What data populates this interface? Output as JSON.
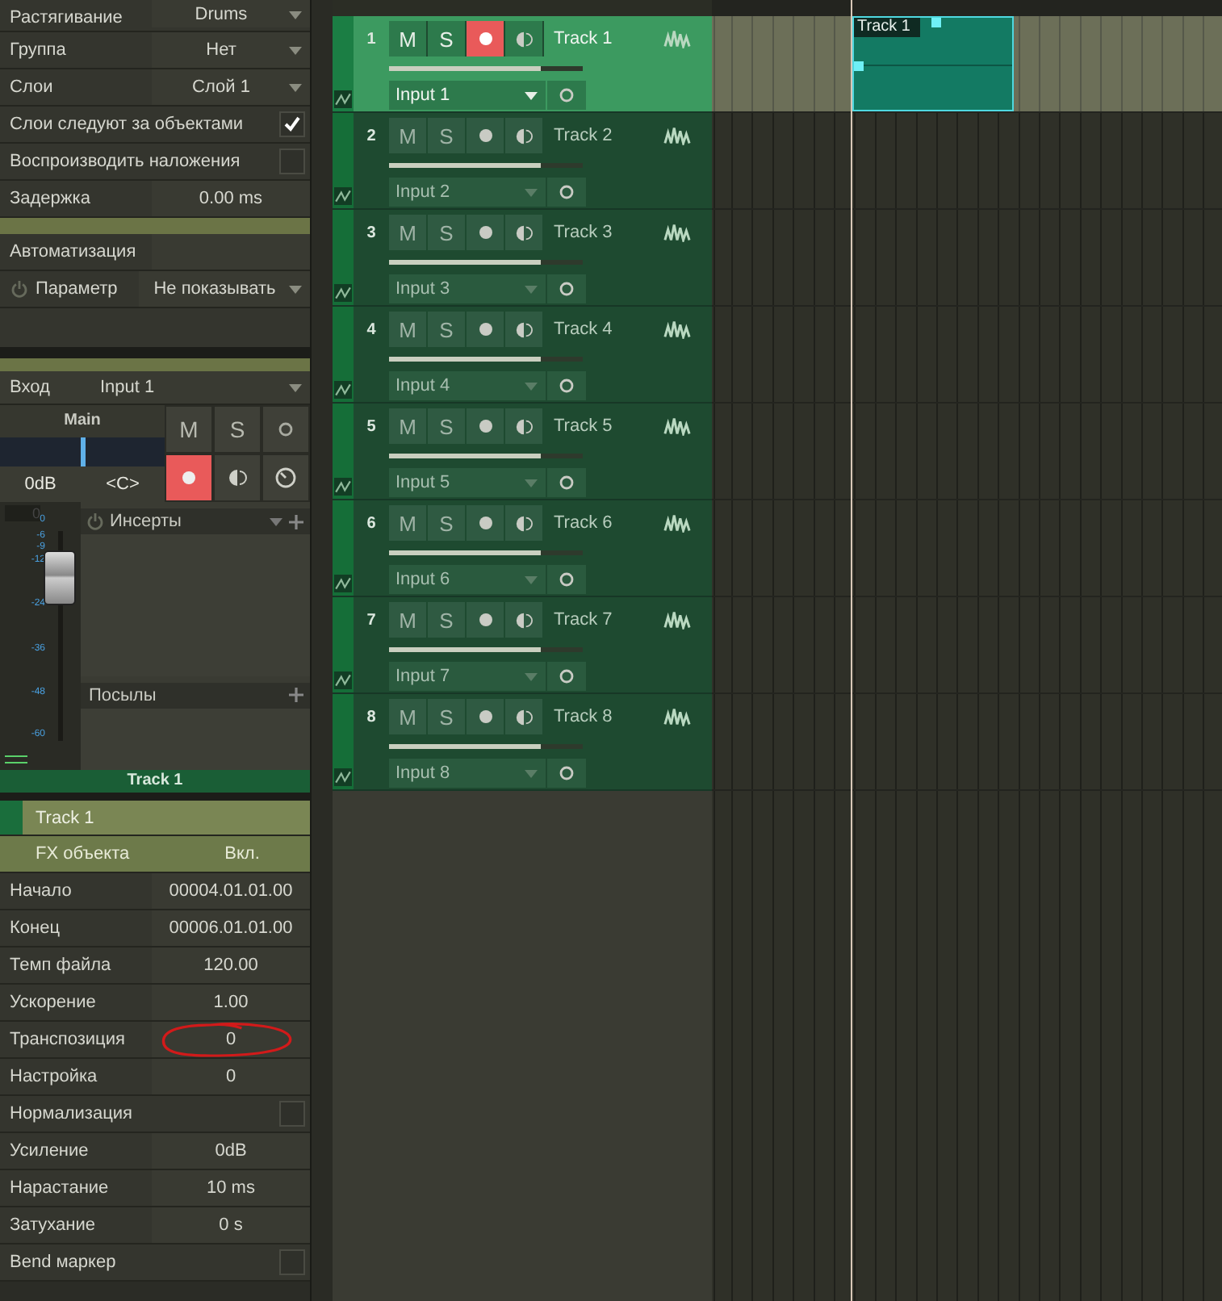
{
  "inspector": {
    "rows": [
      {
        "kind": "select",
        "label": "Растягивание",
        "value": "Drums"
      },
      {
        "kind": "select",
        "label": "Группа",
        "value": "Нет"
      },
      {
        "kind": "select",
        "label": "Слои",
        "value": "Слой 1"
      },
      {
        "kind": "check",
        "label": "Слои следуют за объектами",
        "checked": true
      },
      {
        "kind": "check",
        "label": "Воспроизводить наложения",
        "checked": false
      },
      {
        "kind": "value",
        "label": "Задержка",
        "value": "0.00 ms"
      }
    ]
  },
  "automation": {
    "label": "Автоматизация",
    "param_label": "Параметр",
    "param_value": "Не показывать"
  },
  "input": {
    "label": "Вход",
    "value": "Input 1"
  },
  "channel_strip": {
    "output": "Main",
    "mute_label": "M",
    "solo_label": "S",
    "volume": "0dB",
    "pan": "<C>",
    "record_armed": true,
    "meter_peak": "0",
    "scale": [
      "0",
      "-6",
      "-9",
      "-12",
      "-24",
      "-36",
      "-48",
      "-60"
    ],
    "level": 0.78,
    "inserts_label": "Инсерты",
    "sends_label": "Посылы",
    "name": "Track 1"
  },
  "event_inspector": {
    "title": "Track 1",
    "fx_label": "FX объекта",
    "fx_value": "Вкл.",
    "rows": [
      {
        "kind": "value",
        "label": "Начало",
        "value": "00004.01.01.00",
        "highlighted": false
      },
      {
        "kind": "value",
        "label": "Конец",
        "value": "00006.01.01.00",
        "highlighted": false
      },
      {
        "kind": "value",
        "label": "Темп файла",
        "value": "120.00",
        "highlighted": false
      },
      {
        "kind": "value",
        "label": "Ускорение",
        "value": "1.00",
        "highlighted": false
      },
      {
        "kind": "value",
        "label": "Транспозиция",
        "value": "0",
        "highlighted": true
      },
      {
        "kind": "value",
        "label": "Настройка",
        "value": "0",
        "highlighted": false
      },
      {
        "kind": "check",
        "label": "Нормализация",
        "checked": false
      },
      {
        "kind": "value",
        "label": "Усиление",
        "value": "0dB",
        "highlighted": false
      },
      {
        "kind": "value",
        "label": "Нарастание",
        "value": "10 ms",
        "highlighted": false
      },
      {
        "kind": "value",
        "label": "Затухание",
        "value": "0 s",
        "highlighted": false
      },
      {
        "kind": "check",
        "label": "Bend маркер",
        "checked": false
      }
    ]
  },
  "tracks": [
    {
      "number": "1",
      "mute_label": "M",
      "solo_label": "S",
      "name": "Track 1",
      "input": "Input 1",
      "selected": true,
      "record_armed": true,
      "level": 0.78
    },
    {
      "number": "2",
      "mute_label": "M",
      "solo_label": "S",
      "name": "Track 2",
      "input": "Input 2",
      "selected": false,
      "record_armed": false,
      "level": 0.78
    },
    {
      "number": "3",
      "mute_label": "M",
      "solo_label": "S",
      "name": "Track 3",
      "input": "Input 3",
      "selected": false,
      "record_armed": false,
      "level": 0.78
    },
    {
      "number": "4",
      "mute_label": "M",
      "solo_label": "S",
      "name": "Track 4",
      "input": "Input 4",
      "selected": false,
      "record_armed": false,
      "level": 0.78
    },
    {
      "number": "5",
      "mute_label": "M",
      "solo_label": "S",
      "name": "Track 5",
      "input": "Input 5",
      "selected": false,
      "record_armed": false,
      "level": 0.78
    },
    {
      "number": "6",
      "mute_label": "M",
      "solo_label": "S",
      "name": "Track 6",
      "input": "Input 6",
      "selected": false,
      "record_armed": false,
      "level": 0.78
    },
    {
      "number": "7",
      "mute_label": "M",
      "solo_label": "S",
      "name": "Track 7",
      "input": "Input 7",
      "selected": false,
      "record_armed": false,
      "level": 0.78
    },
    {
      "number": "8",
      "mute_label": "M",
      "solo_label": "S",
      "name": "Track 8",
      "input": "Input 8",
      "selected": false,
      "record_armed": false,
      "level": 0.78
    }
  ],
  "timeline": {
    "clip": {
      "name": "Track 1"
    }
  }
}
